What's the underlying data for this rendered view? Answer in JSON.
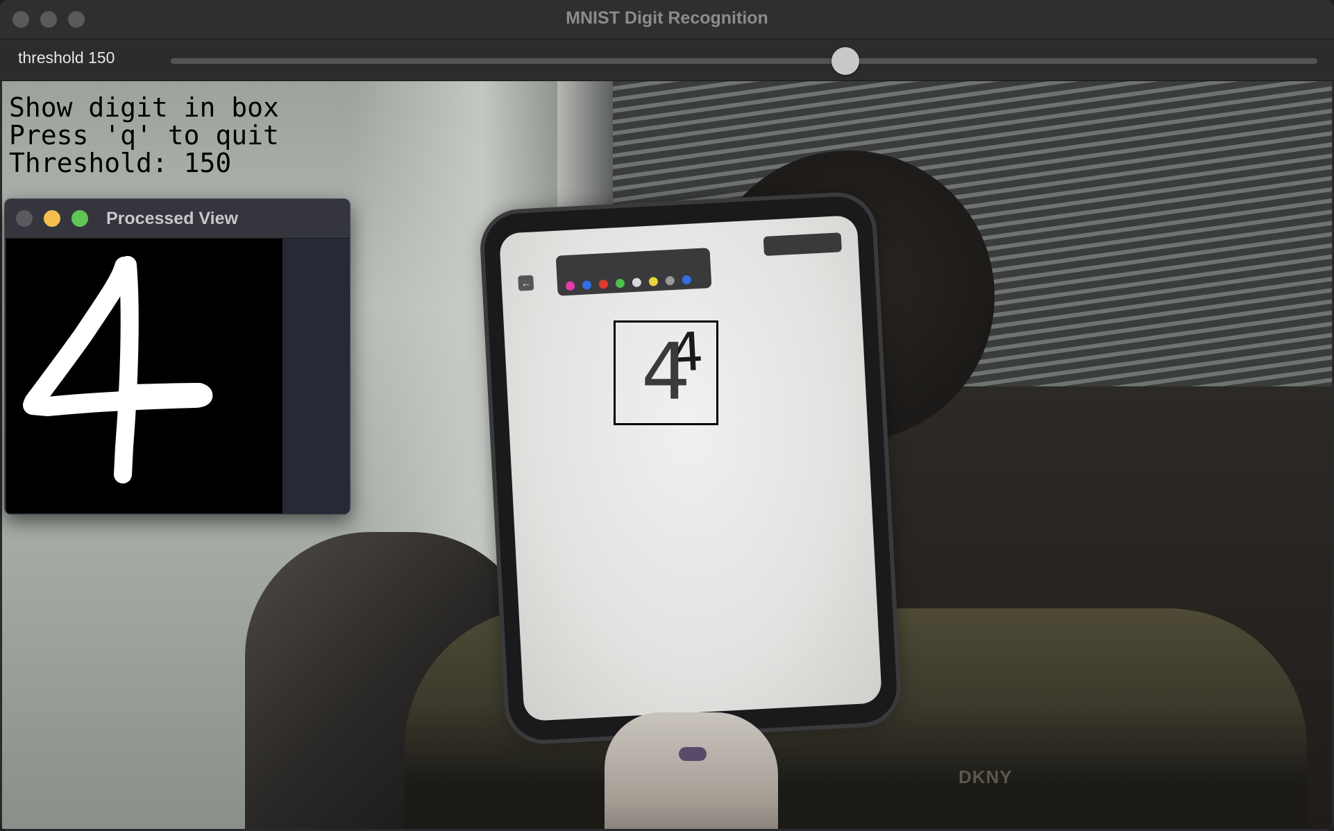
{
  "window": {
    "title": "MNIST Digit Recognition"
  },
  "trackbar": {
    "label": "threshold 150",
    "value": 150,
    "max": 255
  },
  "overlay": {
    "line1": "Show digit in box",
    "line2": "Press 'q' to quit",
    "line3": "Threshold: 150"
  },
  "tablet": {
    "predicted_digit": "4",
    "drawn_digit": "4"
  },
  "camera": {
    "shirt_brand": "DKNY"
  },
  "processed_window": {
    "title": "Processed View"
  },
  "colors": {
    "traffic_close": "#ed6a5e",
    "traffic_minimize": "#f5bf4f",
    "traffic_zoom": "#61c554",
    "inactive_traffic": "#5a5a5c",
    "detection_box": "#000000"
  },
  "icons": {
    "close": "close-icon",
    "minimize": "minimize-icon",
    "zoom": "zoom-icon"
  }
}
